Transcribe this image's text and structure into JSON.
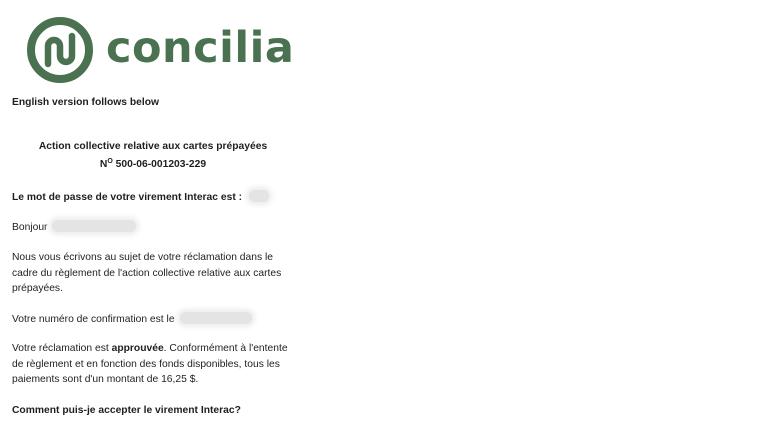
{
  "brand": {
    "name": "concilia",
    "logo_icon": "concilia-logo-icon",
    "color": "#4a7150"
  },
  "email": {
    "english_note": "English version follows below",
    "title": "Action collective relative aux cartes prépayées",
    "number_prefix": "N",
    "number_sup": "O",
    "number_value": " 500-06-001203-229",
    "password_line": "Le mot de passe de votre virement Interac est :",
    "greeting": "Bonjour",
    "intro_lines": [
      "Nous vous écrivons au sujet de votre réclamation dans le",
      "cadre du règlement de l'action collective relative aux cartes",
      "prépayées."
    ],
    "confirmation_text": "Votre numéro de confirmation est le",
    "approved_prefix": "Votre réclamation est ",
    "approved_word": "approuvée",
    "approved_suffix": ". Conformément à l'entente",
    "payment_lines": [
      "de règlement et en fonction des fonds disponibles, tous les",
      "paiements sont d'un montant de 16,25 $."
    ],
    "question": "Comment puis-je accepter le virement Interac?"
  }
}
